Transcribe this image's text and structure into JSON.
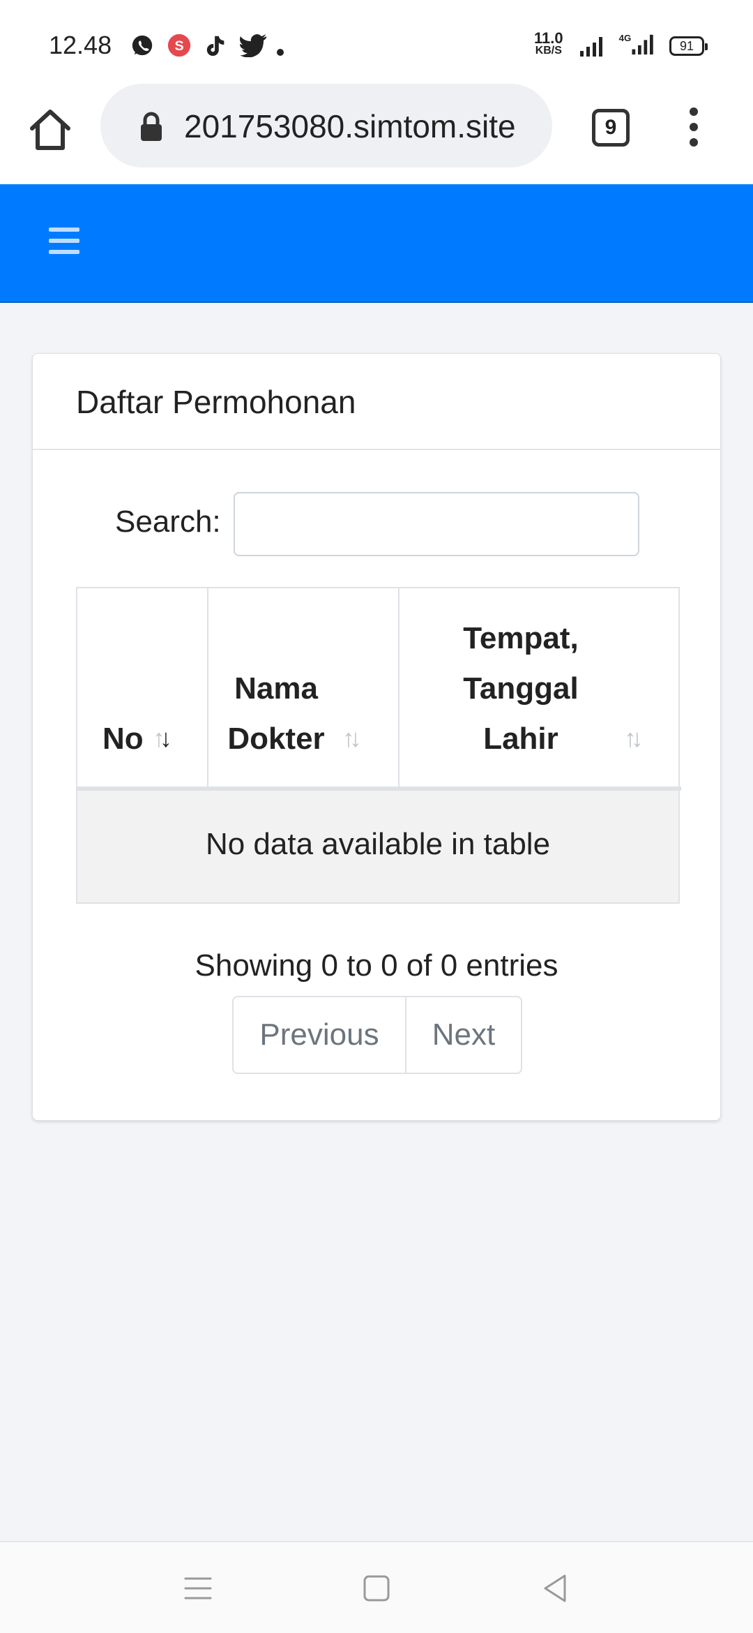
{
  "status_bar": {
    "time": "12.48",
    "net_speed_value": "11.0",
    "net_speed_unit": "KB/S",
    "network_type": "4G",
    "battery": "91",
    "notification_icons": [
      "whatsapp-icon",
      "s-app-icon",
      "tiktok-icon",
      "twitter-icon",
      "dot-icon"
    ]
  },
  "browser": {
    "url": "201753080.simtom.site",
    "tab_count": "9"
  },
  "card": {
    "title": "Daftar Permohonan"
  },
  "search": {
    "label": "Search:",
    "value": ""
  },
  "table": {
    "columns": [
      {
        "label": "No",
        "sort": "descending"
      },
      {
        "label": "Nama Dokter",
        "sort": "none"
      },
      {
        "label": "Tempat, Tanggal Lahir",
        "sort": "none"
      }
    ],
    "empty_message": "No data available in table"
  },
  "pagination": {
    "info": "Showing 0 to 0 of 0 entries",
    "previous_label": "Previous",
    "next_label": "Next"
  },
  "colors": {
    "navbar": "#007bff",
    "page_background": "#f3f4f8"
  }
}
